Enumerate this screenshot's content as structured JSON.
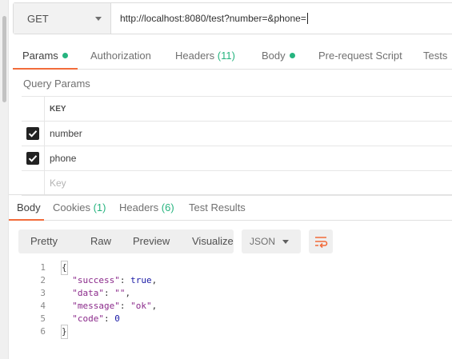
{
  "request": {
    "method": "GET",
    "url": "http://localhost:8080/test?number=&phone="
  },
  "request_tabs": [
    {
      "label": "Params",
      "active": true,
      "dot": true
    },
    {
      "label": "Authorization"
    },
    {
      "label": "Headers",
      "count": "(11)"
    },
    {
      "label": "Body",
      "dot": true
    },
    {
      "label": "Pre-request Script"
    },
    {
      "label": "Tests"
    }
  ],
  "query_params": {
    "title": "Query Params",
    "column_key": "KEY",
    "rows": [
      {
        "key": "number",
        "checked": true
      },
      {
        "key": "phone",
        "checked": true
      }
    ],
    "placeholder": "Key"
  },
  "response_tabs": [
    {
      "label": "Body",
      "active": true
    },
    {
      "label": "Cookies",
      "count": "(1)"
    },
    {
      "label": "Headers",
      "count": "(6)"
    },
    {
      "label": "Test Results"
    }
  ],
  "view_modes": [
    "Pretty",
    "Raw",
    "Preview",
    "Visualize"
  ],
  "format": "JSON",
  "wrap_icon": "wrap-lines-icon",
  "accent_color": "#f26b3a",
  "status_color": "#26b47f",
  "response_lines": [
    {
      "n": "1",
      "text": "{"
    },
    {
      "n": "2",
      "k": "\"success\"",
      "v": "true",
      "t": "bool",
      "comma": ","
    },
    {
      "n": "3",
      "k": "\"data\"",
      "v": "\"\"",
      "t": "str",
      "comma": ","
    },
    {
      "n": "4",
      "k": "\"message\"",
      "v": "\"ok\"",
      "t": "str",
      "comma": ","
    },
    {
      "n": "5",
      "k": "\"code\"",
      "v": "0",
      "t": "num",
      "comma": ""
    },
    {
      "n": "6",
      "text": "}"
    }
  ]
}
